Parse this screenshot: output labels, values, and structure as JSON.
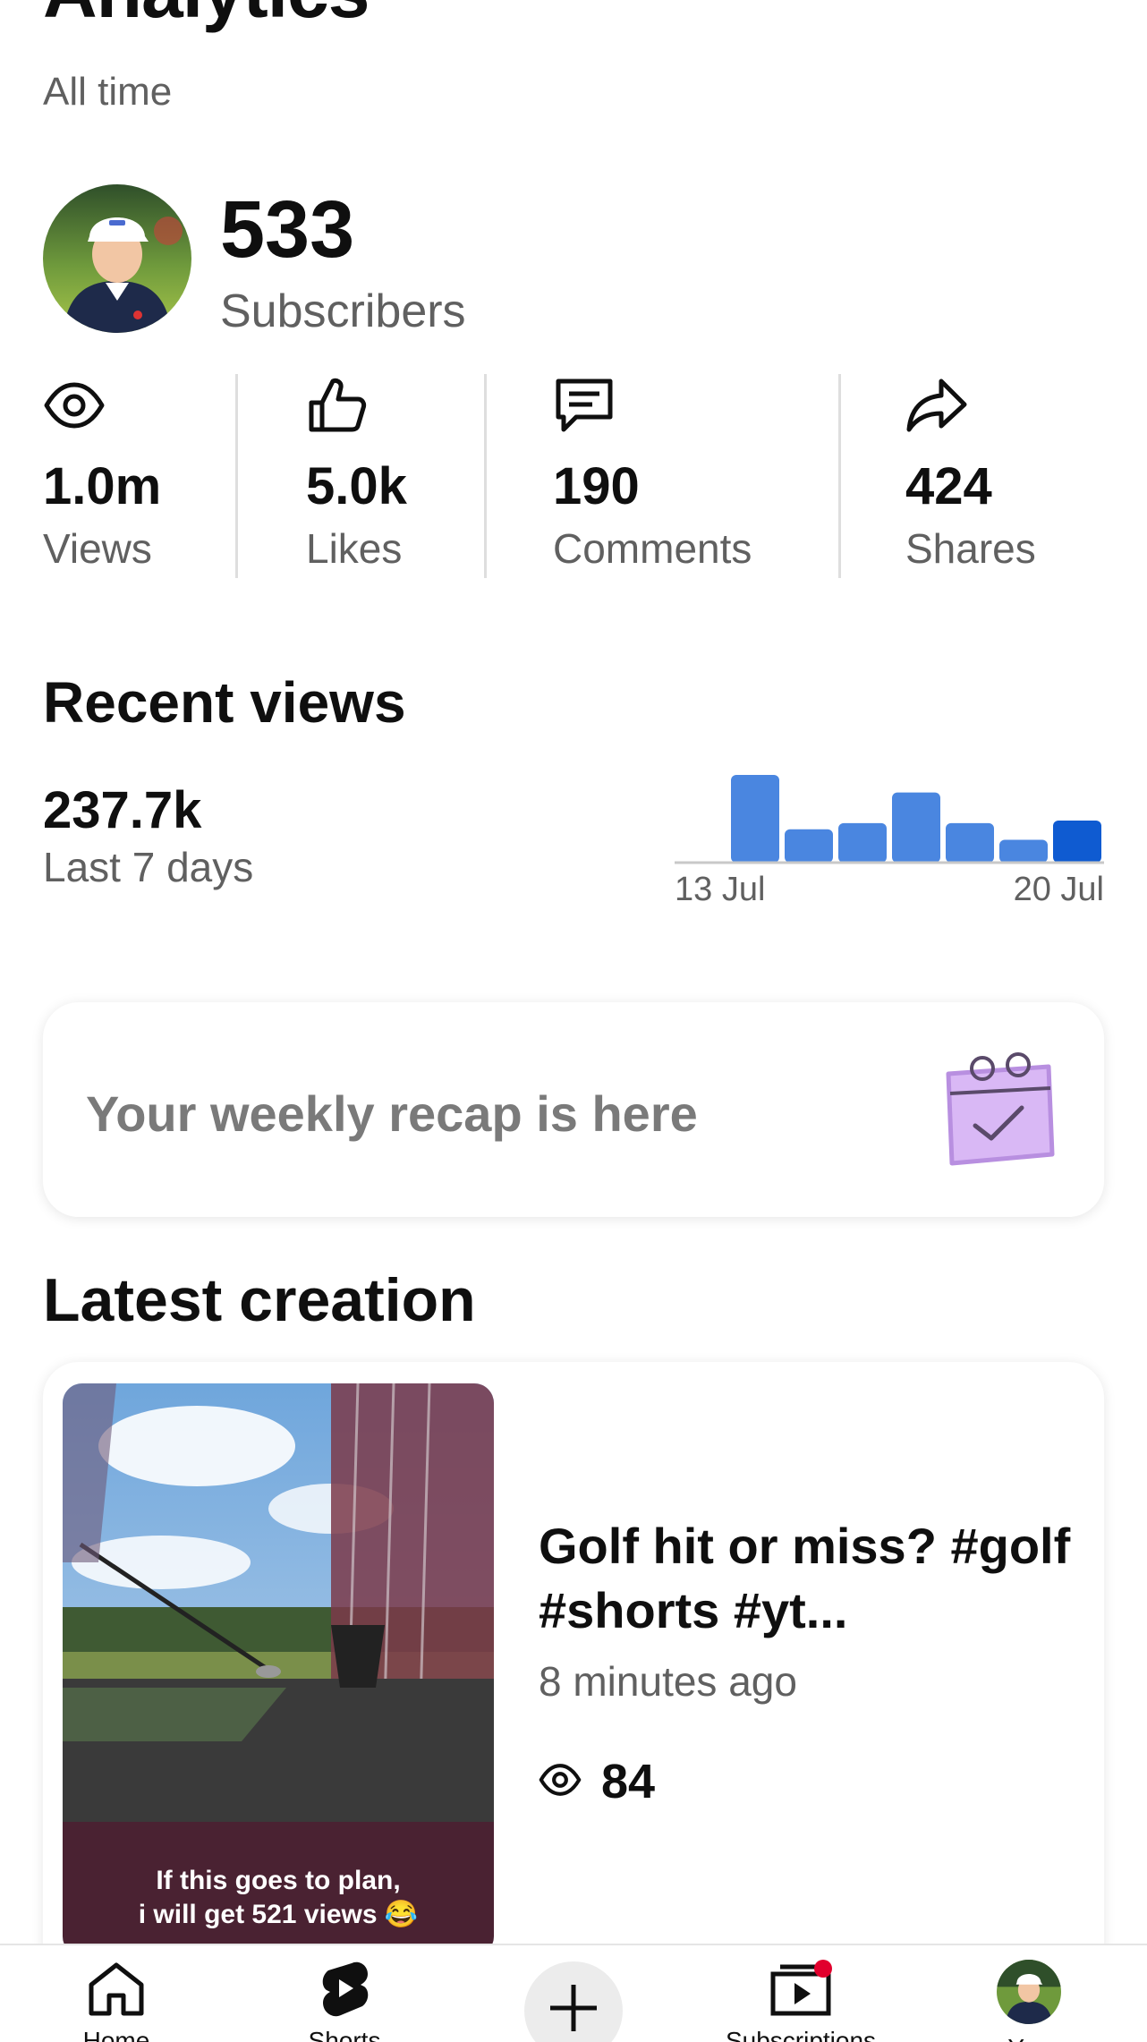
{
  "header": {
    "title": "Analytics",
    "subtitle": "All time"
  },
  "channel": {
    "subscriber_count": "533",
    "subscriber_label": "Subscribers"
  },
  "stats": [
    {
      "icon": "eye-icon",
      "value": "1.0m",
      "label": "Views"
    },
    {
      "icon": "thumbs-up-icon",
      "value": "5.0k",
      "label": "Likes"
    },
    {
      "icon": "comment-icon",
      "value": "190",
      "label": "Comments"
    },
    {
      "icon": "share-icon",
      "value": "424",
      "label": "Shares"
    }
  ],
  "recent_views": {
    "heading": "Recent views",
    "value": "237.7k",
    "period": "Last 7 days",
    "start_label": "13 Jul",
    "end_label": "20 Jul"
  },
  "chart_data": {
    "type": "bar",
    "categories": [
      "13 Jul",
      "14 Jul",
      "15 Jul",
      "16 Jul",
      "17 Jul",
      "18 Jul",
      "19 Jul",
      "20 Jul"
    ],
    "values": [
      0,
      100,
      38,
      45,
      80,
      45,
      26,
      48
    ],
    "tick_labels": [
      "13 Jul",
      "20 Jul"
    ],
    "colors": {
      "bar": "#4a86e0",
      "bar_current": "#0f5bd1",
      "baseline": "#c8c8c8"
    },
    "grid": false
  },
  "recap": {
    "text": "Your weekly recap is here",
    "icon": "calendar-check-icon",
    "icon_color": "#d9b8f5"
  },
  "latest": {
    "heading": "Latest creation",
    "video_title": "Golf hit or miss? #golf #shorts #yt...",
    "thumbnail_caption_line1": "If this goes to plan,",
    "thumbnail_caption_line2": "i will get 521 views 😂",
    "time": "8 minutes ago",
    "views": "84"
  },
  "nav": {
    "home": "Home",
    "shorts": "Shorts",
    "subscriptions": "Subscriptions",
    "you": "You",
    "notification_color": "#e1002d"
  }
}
